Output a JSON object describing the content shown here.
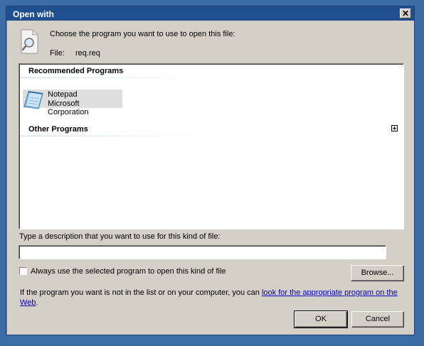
{
  "window": {
    "title": "Open with",
    "close_glyph": "✕"
  },
  "header": {
    "prompt": "Choose the program you want to use to open this file:",
    "file_label": "File:",
    "file_name": "req.req"
  },
  "programs": {
    "recommended_heading": "Recommended Programs",
    "items": [
      {
        "name": "Notepad",
        "vendor": "Microsoft Corporation",
        "icon": "notepad-icon"
      }
    ],
    "other_heading": "Other Programs"
  },
  "description": {
    "label": "Type a description that you want to use for this kind of file:",
    "value": ""
  },
  "always_use": {
    "label": "Always use the selected program to open this kind of file",
    "checked": false
  },
  "browse_label": "Browse...",
  "info": {
    "text": "If the program you want is not in the list or on your computer, you can ",
    "link": "look for the appropriate program on the Web",
    "suffix": "."
  },
  "buttons": {
    "ok": "OK",
    "cancel": "Cancel"
  },
  "colors": {
    "titlebar": "#1f4f8f",
    "dialog": "#d4d0c8",
    "desktop": "#3a6ea5",
    "link": "#0000cc"
  }
}
